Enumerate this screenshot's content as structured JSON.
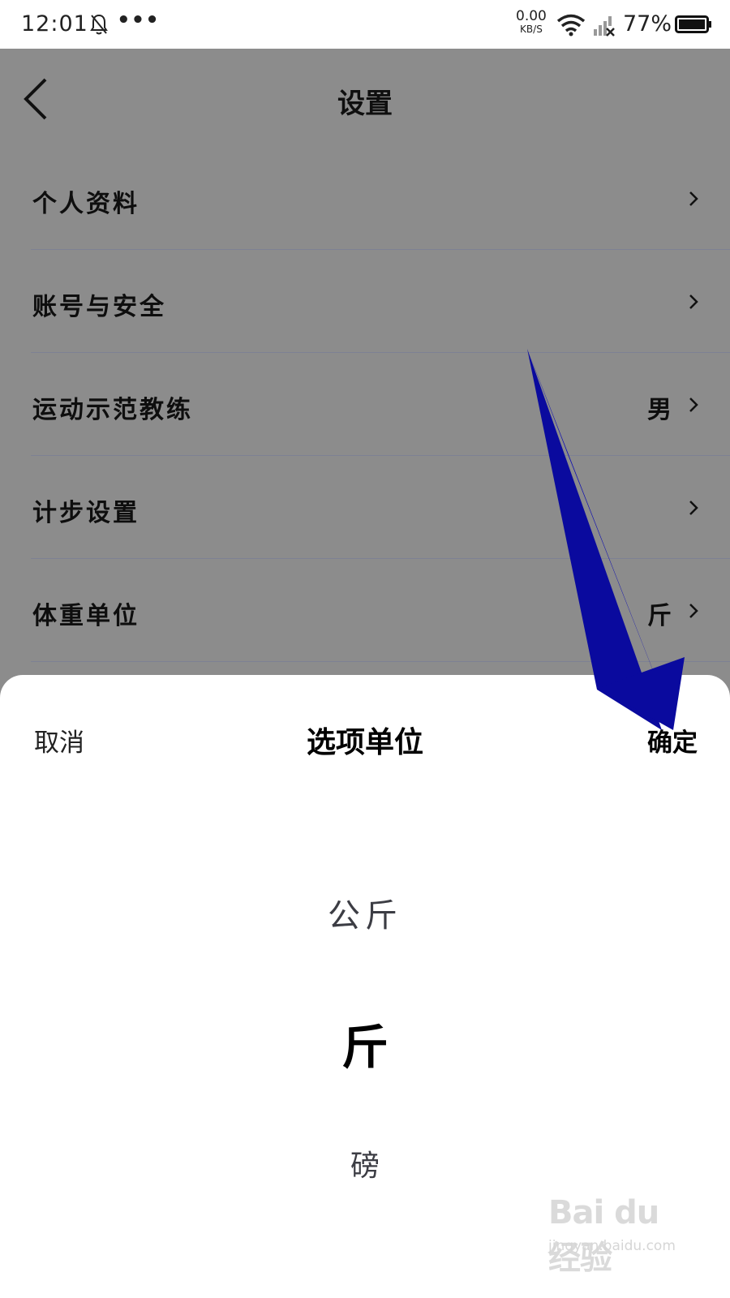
{
  "status_bar": {
    "time": "12:01",
    "more": "•••",
    "net_speed": "0.00",
    "net_unit": "KB/S",
    "battery": "77%"
  },
  "header": {
    "title": "设置",
    "back_icon": "chevron-left-icon"
  },
  "settings": {
    "items": [
      {
        "label": "个人资料",
        "value": ""
      },
      {
        "label": "账号与安全",
        "value": ""
      },
      {
        "label": "运动示范教练",
        "value": "男"
      },
      {
        "label": "计步设置",
        "value": ""
      },
      {
        "label": "体重单位",
        "value": "斤"
      }
    ]
  },
  "sheet": {
    "cancel": "取消",
    "title": "选项单位",
    "confirm": "确定",
    "options": [
      "公斤",
      "斤",
      "磅"
    ],
    "selected": "斤"
  },
  "watermark": {
    "logo": "Bai du 经验",
    "url": "jingyan.baidu.com"
  },
  "colors": {
    "overlay": "#8c8c8c",
    "arrow": "#0a0a9e",
    "sheet_bg": "#ffffff"
  }
}
